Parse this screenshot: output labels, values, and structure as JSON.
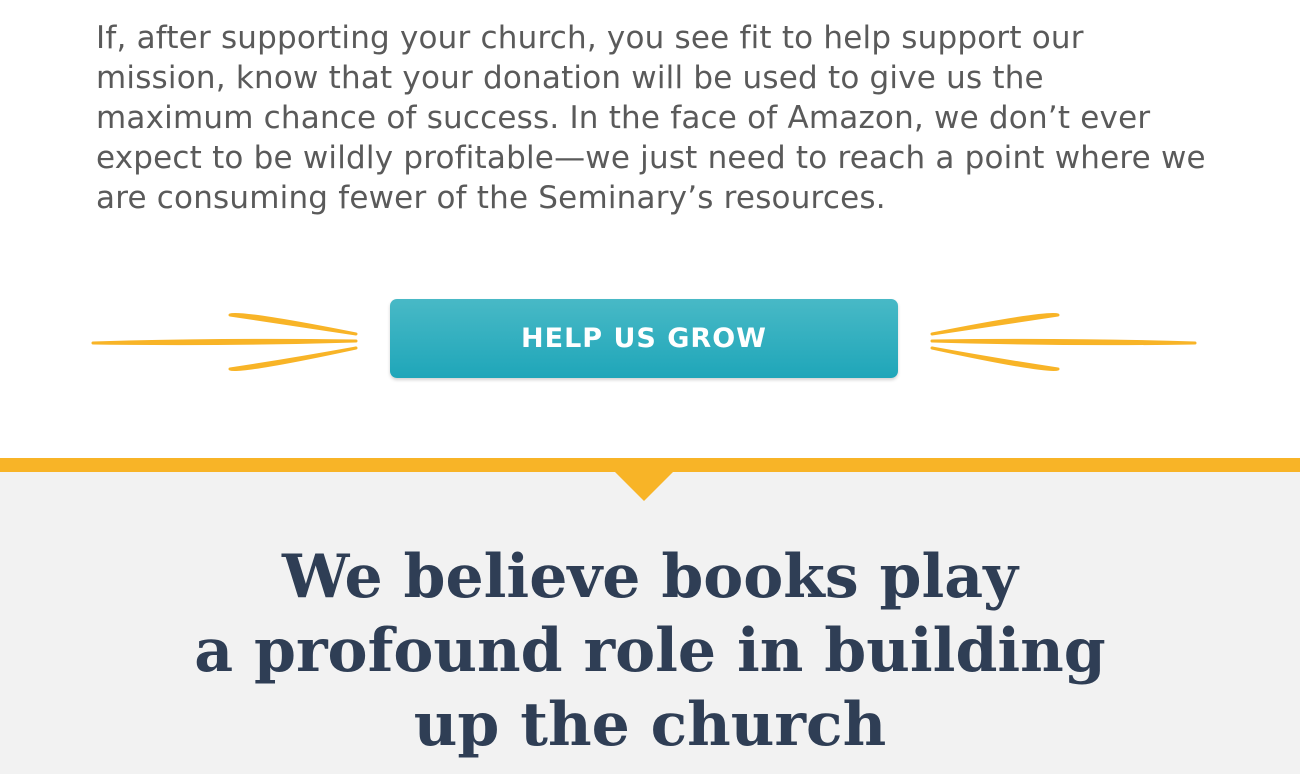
{
  "intro": {
    "paragraph": "If, after supporting your church, you see fit to help support our mission, know that your donation will be used to give us the maximum chance of success. In the face of Amazon, we don’t ever expect to be wildly profitable—we just need to reach a point where we are consuming fewer of the Seminary’s resources."
  },
  "cta": {
    "label": "HELP US GROW",
    "decor_left_icon": "arrow-burst-right",
    "decor_right_icon": "arrow-burst-left"
  },
  "section": {
    "heading_lines": [
      "We believe books play",
      "a profound role in building",
      "up the church"
    ]
  },
  "colors": {
    "text_gray": "#5a5a5a",
    "accent_yellow": "#f8b427",
    "button_teal_top": "#48b9c6",
    "button_teal_bottom": "#1fa6b9",
    "heading_slate": "#2f3e55",
    "section_bg": "#f2f2f2"
  }
}
